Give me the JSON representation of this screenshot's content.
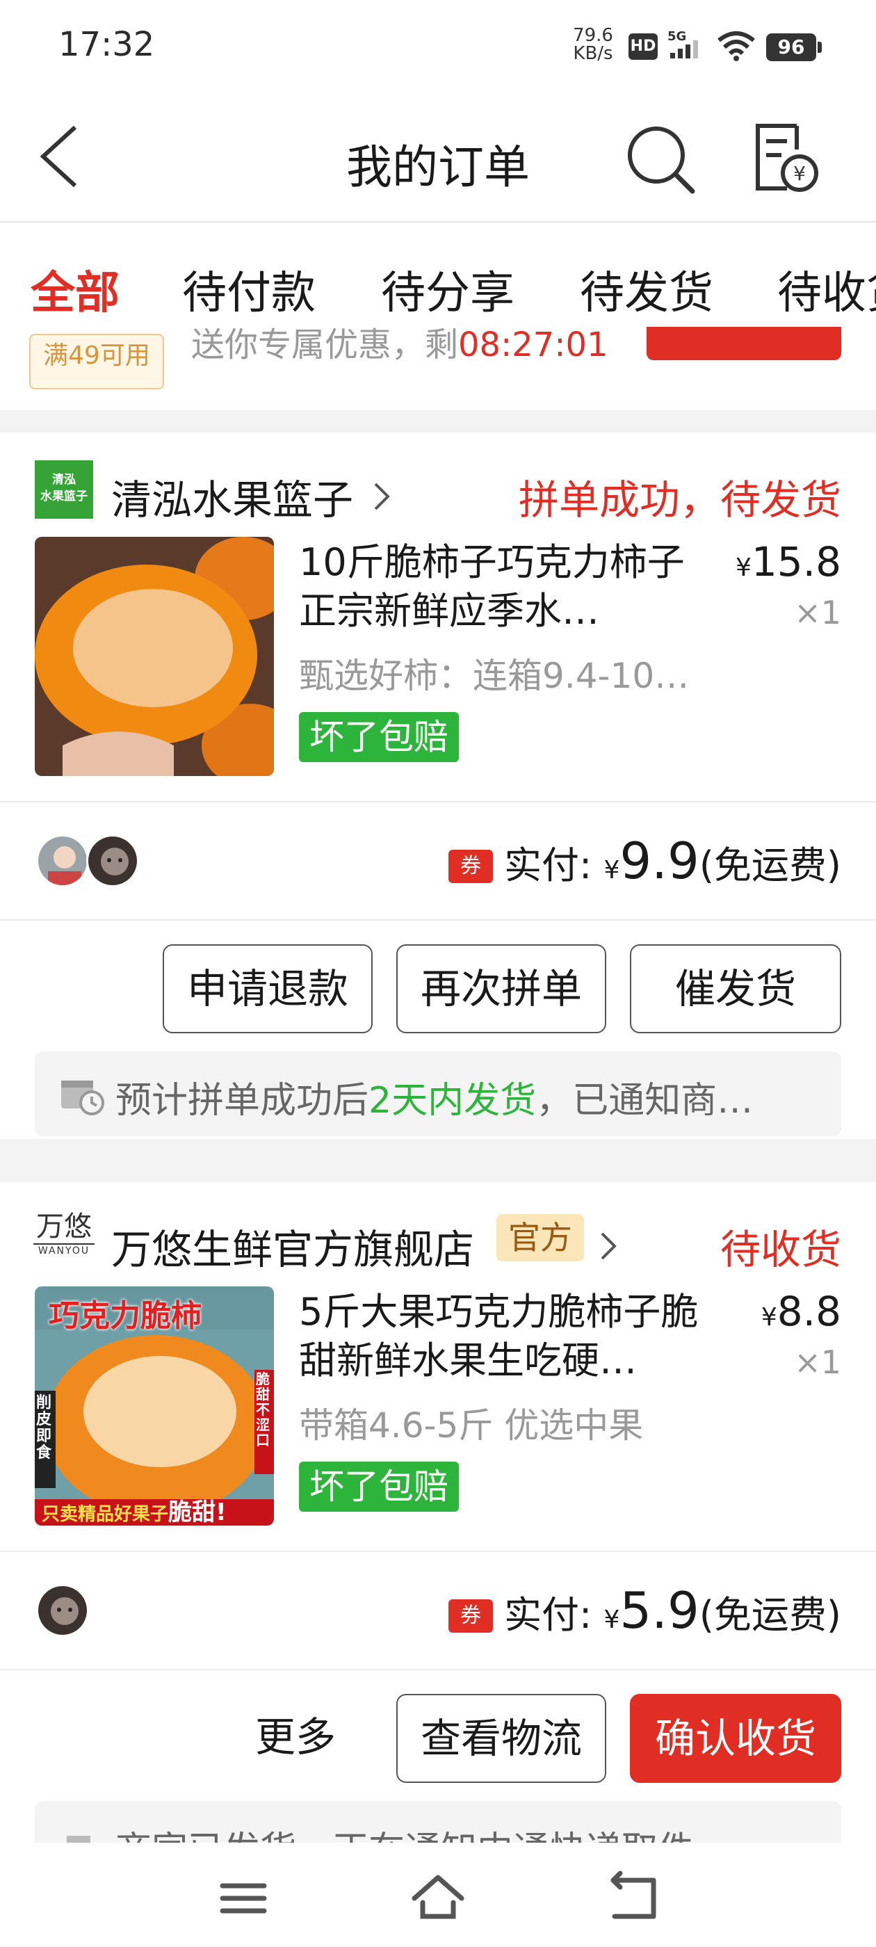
{
  "status_bar": {
    "time": "17:32",
    "net_speed": "79.6",
    "net_unit": "KB/s",
    "hd": "HD",
    "signal": "5G",
    "battery": "96"
  },
  "header": {
    "title": "我的订单",
    "back_icon": "chevron-left-icon",
    "search_icon": "search-icon",
    "bill_icon": "bill-icon"
  },
  "tabs": [
    {
      "label": "全部",
      "active": true
    },
    {
      "label": "待付款"
    },
    {
      "label": "待分享"
    },
    {
      "label": "待发货"
    },
    {
      "label": "待收货"
    }
  ],
  "prev_card": {
    "coupon": "满49可用",
    "promo_text": "送你专属优惠，剩",
    "countdown": "08:27:01"
  },
  "orders": [
    {
      "shop_logo": "清泓\n水果篮子",
      "shop_name": "清泓水果篮子",
      "status": "拼单成功，待发货",
      "product_title": "10斤脆柿子巧克力柿子正宗新鲜应季水…",
      "price_symbol": "¥",
      "price": "15.8",
      "quantity": "×1",
      "spec": "甄选好柿：连箱9.4-10…",
      "badge": "坏了包赔",
      "paid_label": "实付:",
      "coupon_label": "券",
      "paid_amount": "9.9",
      "shipping": "(免运费)",
      "buttons": [
        "申请退款",
        "再次拼单",
        "催发货"
      ],
      "notice_prefix": "预计拼单成功后",
      "notice_highlight": "2天内发货",
      "notice_suffix": "，已通知商…"
    },
    {
      "shop_logo_big": "万悠",
      "shop_logo_small": "WANYOU",
      "shop_name": "万悠生鲜官方旗舰店",
      "official_tag": "官方",
      "status": "待收货",
      "product_title": "5斤大果巧克力脆柿子脆甜新鲜水果生吃硬…",
      "price_symbol": "¥",
      "price": "8.8",
      "quantity": "×1",
      "spec": "带箱4.6-5斤  优选中果",
      "badge": "坏了包赔",
      "image_text_top": "巧克力脆柿",
      "image_text_left": "削皮即食",
      "image_text_right": "脆甜不涩口",
      "image_text_bottom": "只卖精品好果子",
      "image_text_bottom_big": "脆甜!",
      "paid_label": "实付:",
      "coupon_label": "券",
      "paid_amount": "5.9",
      "shipping": "(免运费)",
      "buttons": [
        "更多",
        "查看物流",
        "确认收货"
      ],
      "notice_text": "商家已发货，正在通知中通快递取件"
    }
  ],
  "nav": {
    "menu": "menu-icon",
    "home": "home-icon",
    "back": "back-icon"
  },
  "colors": {
    "accent": "#e02e24",
    "green": "#2db43a",
    "official_bg": "#fbe6b9"
  }
}
